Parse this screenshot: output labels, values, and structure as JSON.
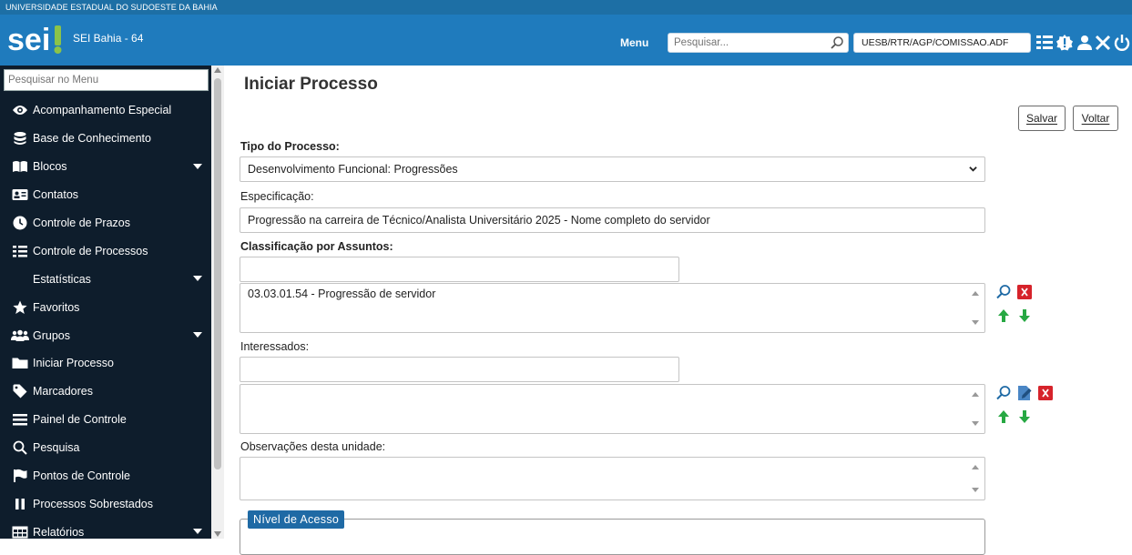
{
  "institution": "UNIVERSIDADE ESTADUAL DO SUDOESTE DA BAHIA",
  "header": {
    "logo_text": "sei",
    "org_name": "SEI Bahia - 64",
    "menu_label": "Menu",
    "search_placeholder": "Pesquisar...",
    "unit": "UESB/RTR/AGP/COMISSAO.ADF",
    "icons": [
      "grid-icon",
      "info-badge-icon",
      "user-icon",
      "tools-icon",
      "power-icon"
    ]
  },
  "sidebar": {
    "search_placeholder": "Pesquisar no Menu",
    "items": [
      {
        "label": "Acompanhamento Especial",
        "icon": "eye-icon",
        "caret": false
      },
      {
        "label": "Base de Conhecimento",
        "icon": "database-icon",
        "caret": false
      },
      {
        "label": "Blocos",
        "icon": "book-icon",
        "caret": true
      },
      {
        "label": "Contatos",
        "icon": "contact-card-icon",
        "caret": false
      },
      {
        "label": "Controle de Prazos",
        "icon": "clock-icon",
        "caret": false
      },
      {
        "label": "Controle de Processos",
        "icon": "list-icon",
        "caret": false
      },
      {
        "label": "Estatísticas",
        "icon": "",
        "caret": true
      },
      {
        "label": "Favoritos",
        "icon": "star-icon",
        "caret": false
      },
      {
        "label": "Grupos",
        "icon": "group-icon",
        "caret": true
      },
      {
        "label": "Iniciar Processo",
        "icon": "folder-icon",
        "caret": false
      },
      {
        "label": "Marcadores",
        "icon": "tag-icon",
        "caret": false
      },
      {
        "label": "Painel de Controle",
        "icon": "panel-icon",
        "caret": false
      },
      {
        "label": "Pesquisa",
        "icon": "search-icon",
        "caret": false
      },
      {
        "label": "Pontos de Controle",
        "icon": "flag-icon",
        "caret": false
      },
      {
        "label": "Processos Sobrestados",
        "icon": "pause-icon",
        "caret": false
      },
      {
        "label": "Relatórios",
        "icon": "table-icon",
        "caret": true
      }
    ]
  },
  "main": {
    "title": "Iniciar Processo",
    "save_label": "Salvar",
    "back_label": "Voltar",
    "tipo_label": "Tipo do Processo:",
    "tipo_value": "Desenvolvimento Funcional: Progressões",
    "especificacao_label": "Especificação:",
    "especificacao_value": "Progressão na carreira de Técnico/Analista Universitário 2025 - Nome completo do servidor",
    "classificacao_label": "Classificação por Assuntos:",
    "classificacao_input": "",
    "classificacao_items": [
      "03.03.01.54 - Progressão de servidor"
    ],
    "interessados_label": "Interessados:",
    "interessados_input": "",
    "observacoes_label": "Observações desta unidade:",
    "nivel_acesso_label": "Nível de Acesso"
  },
  "colors": {
    "header_blue": "#1f7bbd",
    "sidebar_bg": "#0e1d2c",
    "legend_blue": "#1f6aa5",
    "remove_red": "#d6232b",
    "arrow_green": "#27a843"
  }
}
